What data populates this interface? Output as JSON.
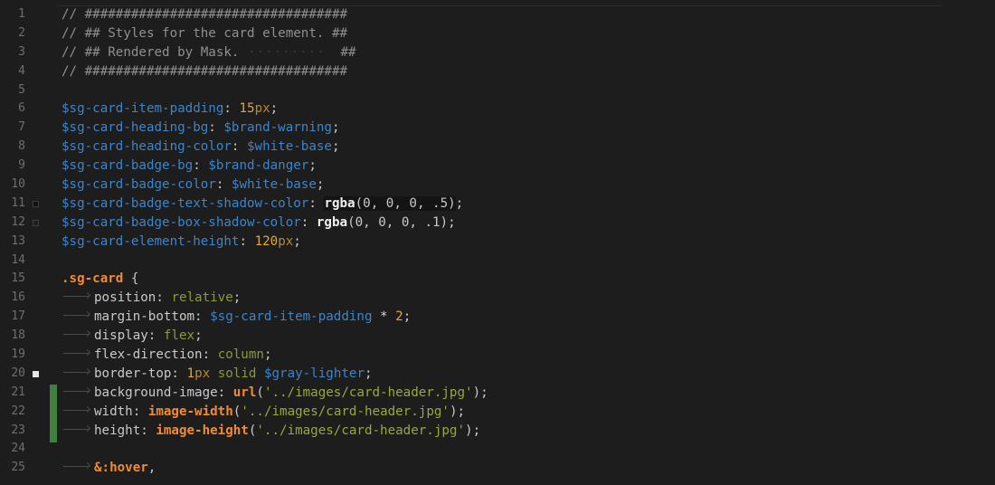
{
  "editor": {
    "line_numbers": [
      "1",
      "2",
      "3",
      "4",
      "5",
      "6",
      "7",
      "8",
      "9",
      "10",
      "11",
      "12",
      "13",
      "14",
      "15",
      "16",
      "17",
      "18",
      "19",
      "20",
      "21",
      "22",
      "23",
      "24",
      "25"
    ],
    "lines": {
      "l1": {
        "c": "// ##################################"
      },
      "l2": {
        "c": "// ## Styles for the card element. ##"
      },
      "l3": {
        "c": "// ## Rendered by Mask.",
        "c2": "##"
      },
      "l4": {
        "c": "// ##################################"
      },
      "l6": {
        "v": "$sg-card-item-padding",
        "p": ":",
        "n": "15",
        "u": "px",
        "e": ";"
      },
      "l7": {
        "v": "$sg-card-heading-bg",
        "p": ":",
        "v2": "$brand-warning",
        "e": ";"
      },
      "l8": {
        "v": "$sg-card-heading-color",
        "p": ":",
        "v2": "$white-base",
        "e": ";"
      },
      "l9": {
        "v": "$sg-card-badge-bg",
        "p": ":",
        "v2": "$brand-danger",
        "e": ";"
      },
      "l10": {
        "v": "$sg-card-badge-color",
        "p": ":",
        "v2": "$white-base",
        "e": ";"
      },
      "l11": {
        "v": "$sg-card-badge-text-shadow-color",
        "p": ":",
        "f": "rgba",
        "a": "(0, 0, 0, .5)",
        "e": ";"
      },
      "l12": {
        "v": "$sg-card-badge-box-shadow-color",
        "p": ":",
        "f": "rgba",
        "a": "(0, 0, 0, .1)",
        "e": ";"
      },
      "l13": {
        "v": "$sg-card-element-height",
        "p": ":",
        "n": "120",
        "u": "px",
        "e": ";"
      },
      "l15": {
        "s": ".sg-card",
        "b": " {"
      },
      "l16": {
        "k": "position",
        "p": ":",
        "w": "relative",
        "e": ";"
      },
      "l17": {
        "k": "margin-bottom",
        "p": ":",
        "v": "$sg-card-item-padding",
        "o": " * ",
        "n": "2",
        "e": ";"
      },
      "l18": {
        "k": "display",
        "p": ":",
        "w": "flex",
        "e": ";"
      },
      "l19": {
        "k": "flex-direction",
        "p": ":",
        "w": "column",
        "e": ";"
      },
      "l20": {
        "k": "border-top",
        "p": ":",
        "n": "1",
        "u": "px",
        "w": "solid",
        "v": "$gray-lighter",
        "e": ";"
      },
      "l21": {
        "k": "background-image",
        "p": ":",
        "f": "url",
        "o1": "(",
        "str": "'../images/card-header.jpg'",
        "o2": ")",
        "e": ";"
      },
      "l22": {
        "k": "width",
        "p": ":",
        "f": "image-width",
        "o1": "(",
        "str": "'../images/card-header.jpg'",
        "o2": ")",
        "e": ";"
      },
      "l23": {
        "k": "height",
        "p": ":",
        "f": "image-height",
        "o1": "(",
        "str": "'../images/card-header.jpg'",
        "o2": ")",
        "e": ";"
      },
      "l25": {
        "s": "&:hover",
        "e": ","
      }
    }
  },
  "colors": {
    "background": "#1d1d1d",
    "comment": "#8f8f8f",
    "variable": "#3d84c9",
    "number": "#e0a83c",
    "keyword": "#8a9a3a",
    "selector": "#f28b2e",
    "change_bar": "#3f7f3f"
  }
}
